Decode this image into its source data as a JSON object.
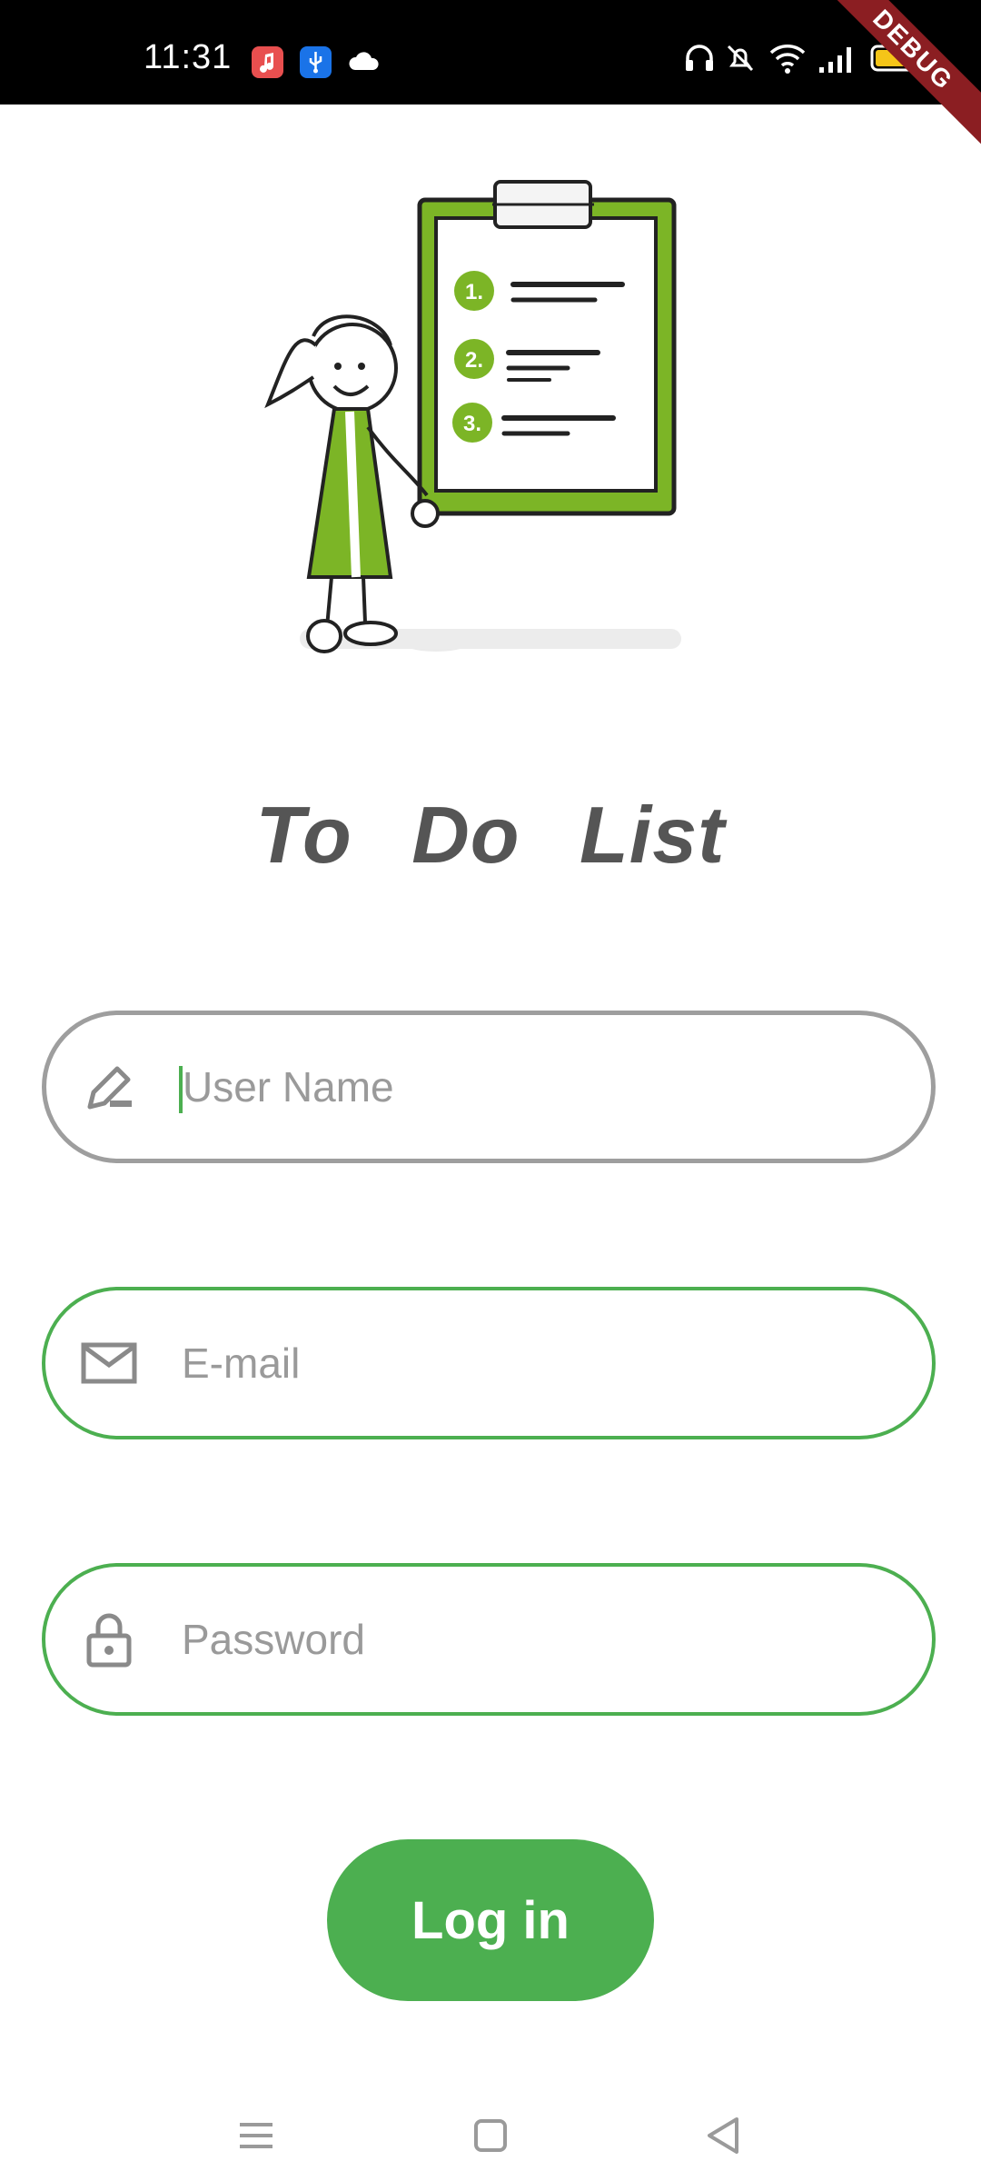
{
  "status_bar": {
    "time": "11:31",
    "app_icons": [
      "music-icon",
      "usb-icon",
      "cloud-icon"
    ],
    "right_icons": [
      "headphones-icon",
      "mute-icon",
      "wifi-icon",
      "signal-icon",
      "battery-icon"
    ],
    "debug_label": "DEBUG"
  },
  "illustration": {
    "list_numbers": [
      "1.",
      "2.",
      "3."
    ]
  },
  "title": "To Do List",
  "form": {
    "username_placeholder": "User Name",
    "email_placeholder": "E-mail",
    "password_placeholder": "Password",
    "login_label": "Log in"
  },
  "nav": {
    "buttons": [
      "menu-icon",
      "home-icon",
      "back-icon"
    ]
  },
  "colors": {
    "accent": "#4caf50",
    "inactive_border": "#9e9e9e",
    "illustration_green": "#7cb526",
    "title": "#555555"
  }
}
